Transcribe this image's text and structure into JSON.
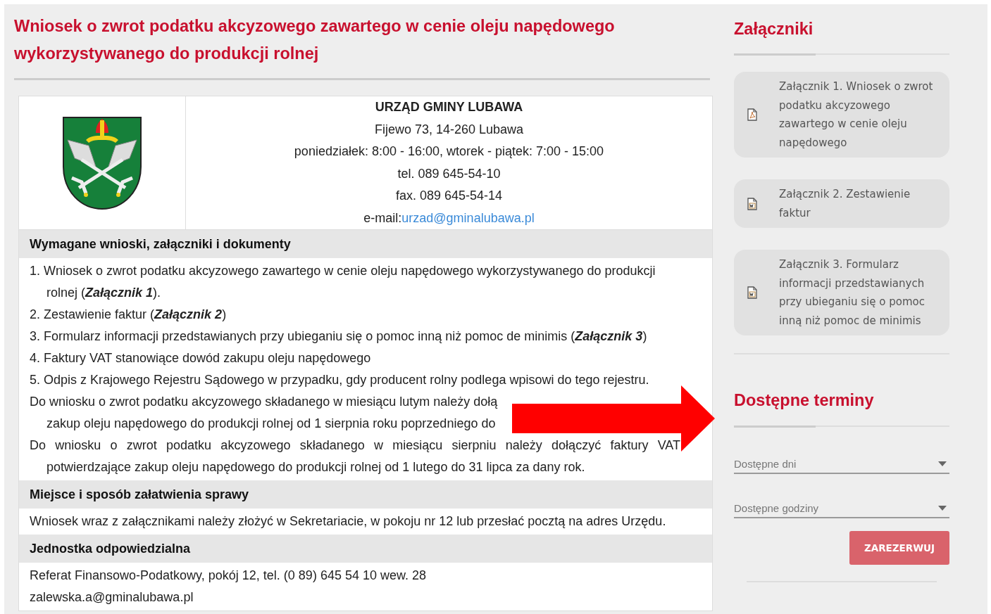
{
  "title": "Wniosek o zwrot podatku akcyzowego zawartego w cenie oleju napędowego wykorzystywanego do produkcji rolnej",
  "office": {
    "name": "URZĄD GMINY LUBAWA",
    "lines": [
      "Fijewo 73, 14-260 Lubawa",
      "poniedziałek: 8:00 - 16:00, wtorek - piątek: 7:00 - 15:00",
      "tel. 089 645-54-10",
      "fax. 089 645-54-14"
    ],
    "email_label": "e-mail:",
    "email": "urzad@gminalubawa.pl"
  },
  "sections": [
    {
      "heading": "Wymagane wnioski, załączniki i dokumenty",
      "blocks": [
        {
          "kind": "item",
          "text": "1. Wniosek o zwrot podatku akcyzowego zawartego w cenie oleju napędowego wykorzystywanego do produkcji rolnej (**Załącznik 1**)."
        },
        {
          "kind": "item",
          "text": "2. Zestawienie faktur (**Załącznik 2**)"
        },
        {
          "kind": "item",
          "text": "3. Formularz informacji przedstawianych przy ubieganiu się o pomoc inną niż pomoc de minimis (**Załącznik 3**)"
        },
        {
          "kind": "item",
          "text": "4. Faktury VAT stanowiące dowód zakupu oleju napędowego"
        },
        {
          "kind": "item",
          "text": "5. Odpis z Krajowego Rejestru Sądowego w przypadku, gdy producent rolny podlega wpisowi do tego rejestru."
        },
        {
          "kind": "covered",
          "lines": [
            "Do wniosku o zwrot podatku akcyzowego składanego w miesiącu lutym należy dołą",
            "zakup oleju napędowego do produkcji rolnej od 1 sierpnia roku poprzedniego do"
          ]
        },
        {
          "kind": "paragraph",
          "text": "Do wniosku o zwrot podatku akcyzowego składanego w miesiącu sierpniu należy dołączyć faktury VAT potwierdzające zakup oleju napędowego do produkcji rolnej od 1 lutego do 31 lipca za dany rok."
        }
      ]
    },
    {
      "heading": "Miejsce i sposób załatwienia sprawy",
      "blocks": [
        {
          "kind": "line",
          "text": "Wniosek wraz z załącznikami należy złożyć w Sekretariacie, w pokoju nr 12 lub przesłać pocztą na adres Urzędu."
        }
      ]
    },
    {
      "heading": "Jednostka odpowiedzialna",
      "blocks": [
        {
          "kind": "line",
          "text": "Referat Finansowo-Podatkowy, pokój 12, tel. (0 89) 645 54 10 wew. 28"
        },
        {
          "kind": "line",
          "text": "zalewska.a@gminalubawa.pl"
        }
      ]
    }
  ],
  "attachments": {
    "heading": "Załączniki",
    "items": [
      {
        "kind": "pdf",
        "label": "Załącznik 1. Wniosek o zwrot podatku akcyzowego zawartego w cenie oleju napędowego"
      },
      {
        "kind": "word",
        "label": "Załącznik 2. Zestawienie faktur"
      },
      {
        "kind": "word",
        "label": "Załącznik 3. Formularz informacji przedstawianych przy ubieganiu się o pomoc inną niż pomoc de minimis"
      }
    ]
  },
  "booking": {
    "heading": "Dostępne terminy",
    "selects": [
      {
        "placeholder": "Dostępne dni"
      },
      {
        "placeholder": "Dostępne godziny"
      }
    ],
    "button": "ZAREZERWUJ"
  }
}
